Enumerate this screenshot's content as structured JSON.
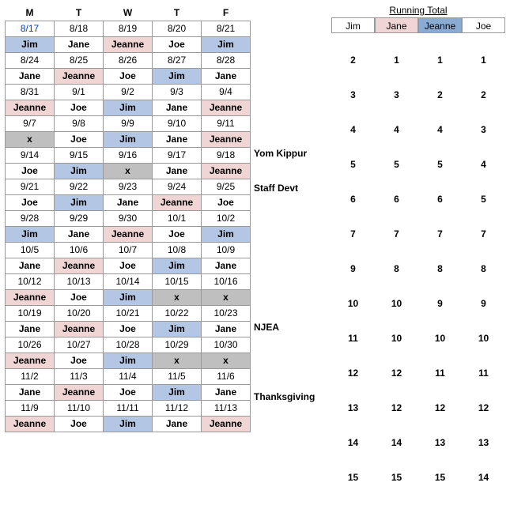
{
  "schedule": {
    "headers": [
      "M",
      "T",
      "W",
      "T",
      "F"
    ],
    "weeks": [
      {
        "dates": [
          "8/17",
          "8/18",
          "8/19",
          "8/20",
          "8/21"
        ],
        "date_colors": [
          "blue",
          "",
          "",
          "",
          ""
        ],
        "assign": [
          "Jim",
          "Jane",
          "Jeanne",
          "Joe",
          "Jim"
        ],
        "class": [
          "c-jim",
          "c-none",
          "c-jeanne",
          "c-none",
          "c-jim"
        ],
        "note": ""
      },
      {
        "dates": [
          "8/24",
          "8/25",
          "8/26",
          "8/27",
          "8/28"
        ],
        "date_colors": [
          "",
          "",
          "",
          "",
          ""
        ],
        "assign": [
          "Jane",
          "Jeanne",
          "Joe",
          "Jim",
          "Jane"
        ],
        "class": [
          "c-none",
          "c-jeanne",
          "c-none",
          "c-jim",
          "c-none"
        ],
        "note": ""
      },
      {
        "dates": [
          "8/31",
          "9/1",
          "9/2",
          "9/3",
          "9/4"
        ],
        "date_colors": [
          "",
          "",
          "",
          "",
          ""
        ],
        "assign": [
          "Jeanne",
          "Joe",
          "Jim",
          "Jane",
          "Jeanne"
        ],
        "class": [
          "c-jeanne",
          "c-none",
          "c-jim",
          "c-none",
          "c-jeanne"
        ],
        "note": ""
      },
      {
        "dates": [
          "9/7",
          "9/8",
          "9/9",
          "9/10",
          "9/11"
        ],
        "date_colors": [
          "",
          "",
          "",
          "",
          ""
        ],
        "assign": [
          "x",
          "Joe",
          "Jim",
          "Jane",
          "Jeanne"
        ],
        "class": [
          "c-x",
          "c-none",
          "c-jim",
          "c-none",
          "c-jeanne"
        ],
        "note": "Yom Kippur"
      },
      {
        "dates": [
          "9/14",
          "9/15",
          "9/16",
          "9/17",
          "9/18"
        ],
        "date_colors": [
          "",
          "",
          "",
          "",
          ""
        ],
        "assign": [
          "Joe",
          "Jim",
          "x",
          "Jane",
          "Jeanne"
        ],
        "class": [
          "c-none",
          "c-jim",
          "c-x",
          "c-none",
          "c-jeanne"
        ],
        "note": "Staff Devt"
      },
      {
        "dates": [
          "9/21",
          "9/22",
          "9/23",
          "9/24",
          "9/25"
        ],
        "date_colors": [
          "",
          "",
          "",
          "",
          ""
        ],
        "assign": [
          "Joe",
          "Jim",
          "Jane",
          "Jeanne",
          "Joe"
        ],
        "class": [
          "c-none",
          "c-jim",
          "c-none",
          "c-jeanne",
          "c-none"
        ],
        "note": ""
      },
      {
        "dates": [
          "9/28",
          "9/29",
          "9/30",
          "10/1",
          "10/2"
        ],
        "date_colors": [
          "",
          "",
          "",
          "",
          ""
        ],
        "assign": [
          "Jim",
          "Jane",
          "Jeanne",
          "Joe",
          "Jim"
        ],
        "class": [
          "c-jim",
          "c-none",
          "c-jeanne",
          "c-none",
          "c-jim"
        ],
        "note": ""
      },
      {
        "dates": [
          "10/5",
          "10/6",
          "10/7",
          "10/8",
          "10/9"
        ],
        "date_colors": [
          "",
          "",
          "",
          "",
          ""
        ],
        "assign": [
          "Jane",
          "Jeanne",
          "Joe",
          "Jim",
          "Jane"
        ],
        "class": [
          "c-none",
          "c-jeanne",
          "c-none",
          "c-jim",
          "c-none"
        ],
        "note": ""
      },
      {
        "dates": [
          "10/12",
          "10/13",
          "10/14",
          "10/15",
          "10/16"
        ],
        "date_colors": [
          "",
          "",
          "",
          "",
          ""
        ],
        "assign": [
          "Jeanne",
          "Joe",
          "Jim",
          "x",
          "x"
        ],
        "class": [
          "c-jeanne",
          "c-none",
          "c-jim",
          "c-x",
          "c-x"
        ],
        "note": "NJEA"
      },
      {
        "dates": [
          "10/19",
          "10/20",
          "10/21",
          "10/22",
          "10/23"
        ],
        "date_colors": [
          "",
          "",
          "",
          "",
          ""
        ],
        "assign": [
          "Jane",
          "Jeanne",
          "Joe",
          "Jim",
          "Jane"
        ],
        "class": [
          "c-none",
          "c-jeanne",
          "c-none",
          "c-jim",
          "c-none"
        ],
        "note": ""
      },
      {
        "dates": [
          "10/26",
          "10/27",
          "10/28",
          "10/29",
          "10/30"
        ],
        "date_colors": [
          "",
          "",
          "",
          "",
          ""
        ],
        "assign": [
          "Jeanne",
          "Joe",
          "Jim",
          "x",
          "x"
        ],
        "class": [
          "c-jeanne",
          "c-none",
          "c-jim",
          "c-x",
          "c-x"
        ],
        "note": "Thanksgiving"
      },
      {
        "dates": [
          "11/2",
          "11/3",
          "11/4",
          "11/5",
          "11/6"
        ],
        "date_colors": [
          "",
          "",
          "",
          "",
          ""
        ],
        "assign": [
          "Jane",
          "Jeanne",
          "Joe",
          "Jim",
          "Jane"
        ],
        "class": [
          "c-none",
          "c-jeanne",
          "c-none",
          "c-jim",
          "c-none"
        ],
        "note": ""
      },
      {
        "dates": [
          "11/9",
          "11/10",
          "11/11",
          "11/12",
          "11/13"
        ],
        "date_colors": [
          "",
          "",
          "",
          "",
          ""
        ],
        "assign": [
          "Jeanne",
          "Joe",
          "Jim",
          "Jane",
          "Jeanne"
        ],
        "class": [
          "c-jeanne",
          "c-none",
          "c-jim",
          "c-none",
          "c-jeanne"
        ],
        "note": ""
      }
    ]
  },
  "running_total": {
    "title": "Running Total",
    "headers": [
      "Jim",
      "Jane",
      "Jeanne",
      "Joe"
    ],
    "rows": [
      [
        2,
        1,
        1,
        1
      ],
      [
        3,
        3,
        2,
        2
      ],
      [
        4,
        4,
        4,
        3
      ],
      [
        5,
        5,
        5,
        4
      ],
      [
        6,
        6,
        6,
        5
      ],
      [
        7,
        7,
        7,
        7
      ],
      [
        9,
        8,
        8,
        8
      ],
      [
        10,
        10,
        9,
        9
      ],
      [
        11,
        10,
        10,
        10
      ],
      [
        12,
        12,
        11,
        11
      ],
      [
        13,
        12,
        12,
        12
      ],
      [
        14,
        14,
        13,
        13
      ],
      [
        15,
        15,
        15,
        14
      ]
    ]
  }
}
